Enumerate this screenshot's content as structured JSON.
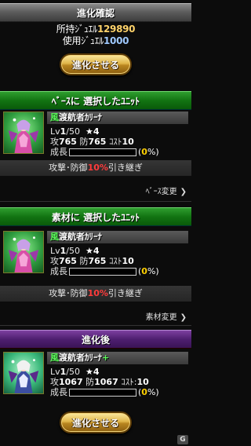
{
  "header": {
    "title": "進化確認"
  },
  "jewels": {
    "owned_label": "所持ｼﾞｭｴﾙ",
    "owned_value": "129890",
    "used_label": "使用ｼﾞｭｴﾙ",
    "used_value": "1000"
  },
  "evolve_button_top": "進化させる",
  "base_section": {
    "title": "ﾍﾞｰｽに 選択したﾕﾆｯﾄ",
    "unit": {
      "attr": "風",
      "name": "渡航者ｶﾘｰﾅ",
      "lv_label": "Lv",
      "lv": "1",
      "lv_max": "/50",
      "stars": "4",
      "atk_label": "攻",
      "atk": "765",
      "def_label": "防",
      "def": "765",
      "cost_label": "ｺｽﾄ",
      "cost": "10",
      "growth_label": "成長",
      "growth_pct": "0",
      "growth_fraction": 0
    },
    "inherit": {
      "prefix": "攻撃･防御",
      "value": "10%",
      "suffix": "引き継ぎ"
    },
    "change_label": "ﾍﾞｰｽ変更"
  },
  "material_section": {
    "title": "素材に 選択したﾕﾆｯﾄ",
    "unit": {
      "attr": "風",
      "name": "渡航者ｶﾘｰﾅ",
      "lv_label": "Lv",
      "lv": "1",
      "lv_max": "/50",
      "stars": "4",
      "atk_label": "攻",
      "atk": "765",
      "def_label": "防",
      "def": "765",
      "cost_label": "ｺｽﾄ",
      "cost": "10",
      "growth_label": "成長",
      "growth_pct": "0",
      "growth_fraction": 0
    },
    "inherit": {
      "prefix": "攻撃･防御",
      "value": "10%",
      "suffix": "引き継ぎ"
    },
    "change_label": "素材変更"
  },
  "after_section": {
    "title": "進化後",
    "unit": {
      "attr": "風",
      "name": "渡航者ｶﾘｰﾅ",
      "plus": "+",
      "lv_label": "Lv",
      "lv": "1",
      "lv_max": "/50",
      "stars": "4",
      "atk_label": "攻",
      "atk": "1067",
      "def_label": "防",
      "def": "1067",
      "cost_label": "ｺｽﾄ:",
      "cost": "10",
      "growth_label": "成長",
      "growth_pct": "0",
      "growth_fraction": 0
    }
  },
  "evolve_button_bottom": "進化させる",
  "watermark": "G",
  "icons": {
    "star": "star-icon",
    "chevron": "chevron-right-icon"
  },
  "colors": {
    "accent_green": "#127412",
    "accent_purple": "#4e1f70",
    "gold": "#e0b64a",
    "red_text": "#ff3b3b"
  }
}
